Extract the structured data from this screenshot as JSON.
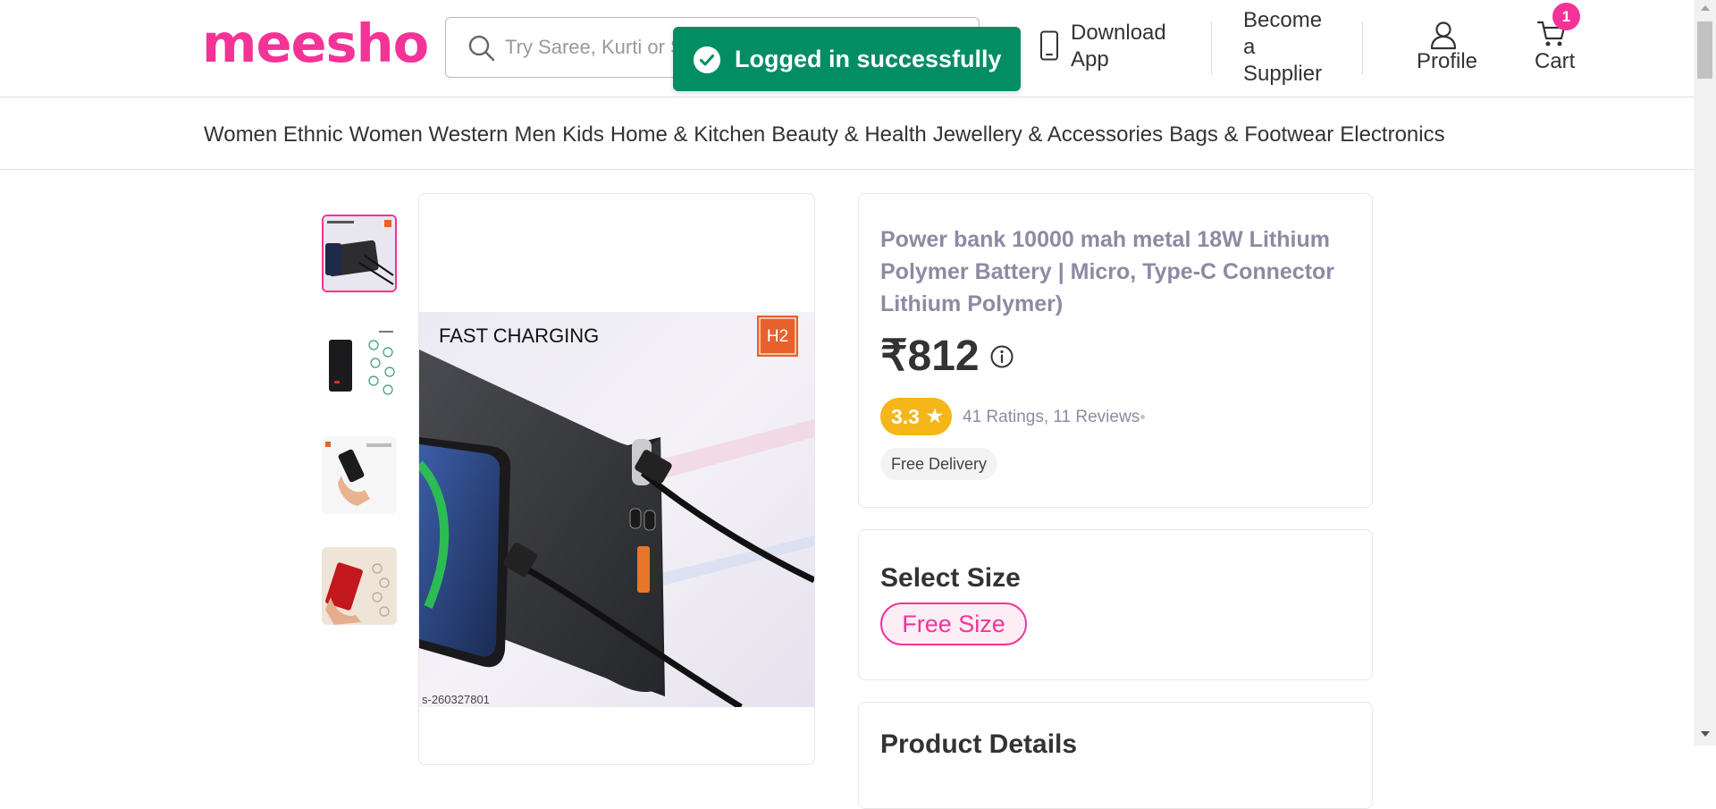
{
  "header": {
    "logo": "meesho",
    "search_placeholder": "Try Saree, Kurti or Search by Product Code",
    "download": [
      "Download",
      "App"
    ],
    "supplier": [
      "Become",
      "a",
      "Supplier"
    ],
    "profile": "Profile",
    "cart": "Cart",
    "cart_count": "1"
  },
  "toast": {
    "message": "Logged in successfully"
  },
  "categories": [
    "Women Ethnic",
    "Women Western",
    "Men",
    "Kids",
    "Home & Kitchen",
    "Beauty & Health",
    "Jewellery & Accessories",
    "Bags & Footwear",
    "Electronics"
  ],
  "gallery": {
    "image_caption": "FAST CHARGING",
    "brand_mark": "H2",
    "image_code": "s-260327801"
  },
  "product": {
    "title": "Power bank 10000 mah metal 18W Lithium Polymer Battery | Micro, Type-C Connector Lithium Polymer)",
    "price": "₹812",
    "rating": "3.3",
    "reviews": "41 Ratings, 11 Reviews",
    "delivery": "Free Delivery"
  },
  "size": {
    "heading": "Select Size",
    "option": "Free Size"
  },
  "details": {
    "heading": "Product Details"
  },
  "colors": {
    "brand": "#f43397",
    "toast": "#038d63",
    "rating": "#f4b619"
  }
}
